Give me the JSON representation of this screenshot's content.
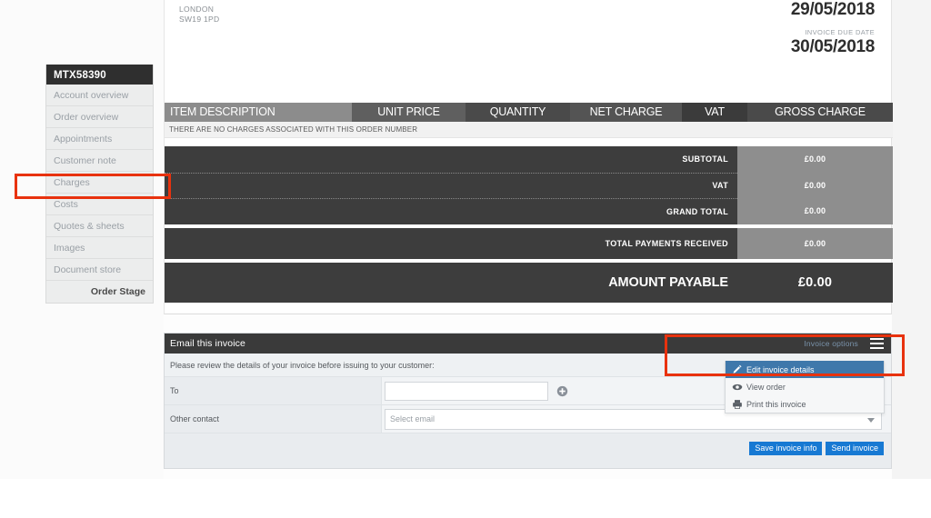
{
  "sidebar": {
    "header": "MTX58390",
    "items": [
      {
        "label": "Account overview",
        "name": "account-overview"
      },
      {
        "label": "Order overview",
        "name": "order-overview"
      },
      {
        "label": "Appointments",
        "name": "appointments"
      },
      {
        "label": "Customer note",
        "name": "customer-note"
      },
      {
        "label": "Charges",
        "name": "charges"
      },
      {
        "label": "Costs",
        "name": "costs"
      },
      {
        "label": "Quotes & sheets",
        "name": "quotes-sheets"
      },
      {
        "label": "Images",
        "name": "images"
      },
      {
        "label": "Document store",
        "name": "document-store"
      }
    ],
    "order_stage": "Order Stage"
  },
  "invoice": {
    "address": {
      "city": "LONDON",
      "postcode": "SW19 1PD"
    },
    "invoice_date": "29/05/2018",
    "due_date_label": "INVOICE DUE DATE",
    "due_date": "30/05/2018",
    "table": {
      "columns": [
        "ITEM DESCRIPTION",
        "UNIT PRICE",
        "QUANTITY",
        "NET CHARGE",
        "VAT",
        "GROSS CHARGE"
      ],
      "empty_message": "THERE ARE NO CHARGES ASSOCIATED WITH THIS ORDER NUMBER"
    },
    "totals": [
      {
        "label": "SUBTOTAL",
        "value": "£0.00"
      },
      {
        "label": "VAT",
        "value": "£0.00"
      },
      {
        "label": "GRAND TOTAL",
        "value": "£0.00"
      }
    ],
    "payments": {
      "label": "TOTAL PAYMENTS RECEIVED",
      "value": "£0.00"
    },
    "amount_payable": {
      "label": "AMOUNT PAYABLE",
      "value": "£0.00"
    }
  },
  "email_panel": {
    "title": "Email this invoice",
    "options_label": "Invoice options",
    "review_text": "Please review the details of your invoice before issuing to your customer:",
    "to_label": "To",
    "to_value": "",
    "to_placeholder": "",
    "other_contact_label": "Other contact",
    "other_contact_placeholder": "Select email",
    "save_button": "Save invoice info",
    "send_button": "Send invoice"
  },
  "dropdown": {
    "items": [
      {
        "label": "Edit invoice details",
        "icon": "pencil-icon",
        "active": true
      },
      {
        "label": "View order",
        "icon": "eye-icon",
        "active": false
      },
      {
        "label": "Print this invoice",
        "icon": "printer-icon",
        "active": false
      }
    ]
  },
  "colors": {
    "accent_blue": "#1779d3",
    "menu_active": "#3f78ab",
    "dark_panel": "#3d3d3d",
    "value_gray": "#8e8e8e",
    "annotation_red": "#e8320e"
  }
}
